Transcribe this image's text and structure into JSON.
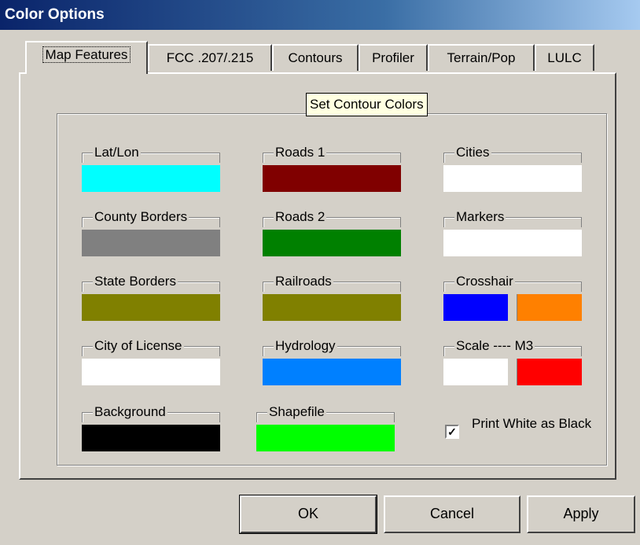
{
  "window": {
    "title": "Color Options"
  },
  "tabs": [
    {
      "label": "Map Features",
      "active": true
    },
    {
      "label": "FCC .207/.215"
    },
    {
      "label": "Contours"
    },
    {
      "label": "Profiler"
    },
    {
      "label": "Terrain/Pop"
    },
    {
      "label": "LULC"
    }
  ],
  "tooltip": "Set Contour Colors",
  "features": {
    "latlon": {
      "label": "Lat/Lon",
      "color": "#00ffff"
    },
    "county": {
      "label": "County Borders",
      "color": "#808080"
    },
    "state": {
      "label": "State Borders",
      "color": "#808000"
    },
    "license": {
      "label": "City of License",
      "color": "#ffffff"
    },
    "background": {
      "label": "Background",
      "color": "#000000"
    },
    "roads1": {
      "label": "Roads 1",
      "color": "#800000"
    },
    "roads2": {
      "label": "Roads 2",
      "color": "#008000"
    },
    "railroads": {
      "label": "Railroads",
      "color": "#808000"
    },
    "hydrology": {
      "label": "Hydrology",
      "color": "#0080ff"
    },
    "shapefile": {
      "label": "Shapefile",
      "color": "#00ff00"
    },
    "cities": {
      "label": "Cities",
      "color": "#ffffff"
    },
    "markers": {
      "label": "Markers",
      "color": "#ffffff"
    },
    "crosshair": {
      "label": "Crosshair",
      "color1": "#0000ff",
      "color2": "#ff8000"
    },
    "scale": {
      "label": "Scale ---- M3",
      "color1": "#ffffff",
      "color2": "#ff0000"
    }
  },
  "print_white": {
    "label": "Print White as Black",
    "checked": true,
    "mark": "✓"
  },
  "buttons": {
    "ok": "OK",
    "cancel": "Cancel",
    "apply": "Apply"
  }
}
